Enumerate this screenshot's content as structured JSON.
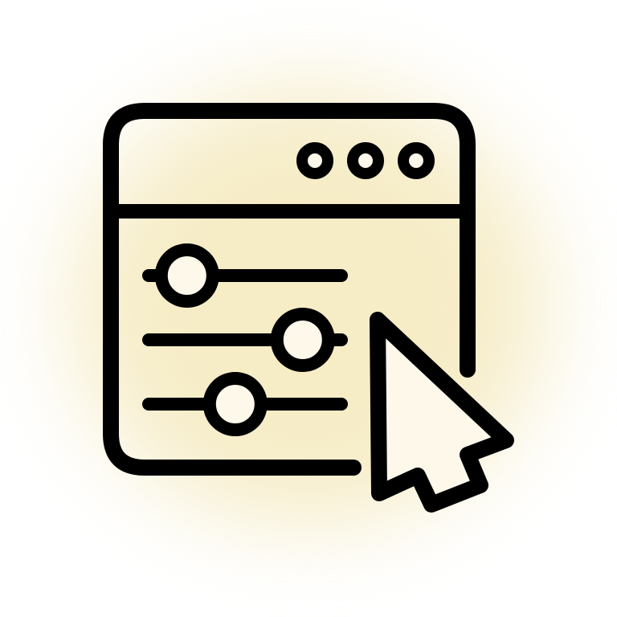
{
  "icon": {
    "name": "browser-settings-cursor-icon",
    "parts": [
      "window-frame",
      "window-dots",
      "slider-controls",
      "cursor-arrow"
    ],
    "slider_levels": [
      0.22,
      0.82,
      0.47
    ]
  },
  "colors": {
    "stroke": "#000000",
    "fill": "#fdf8ea",
    "glow": "#f3e6b4"
  }
}
